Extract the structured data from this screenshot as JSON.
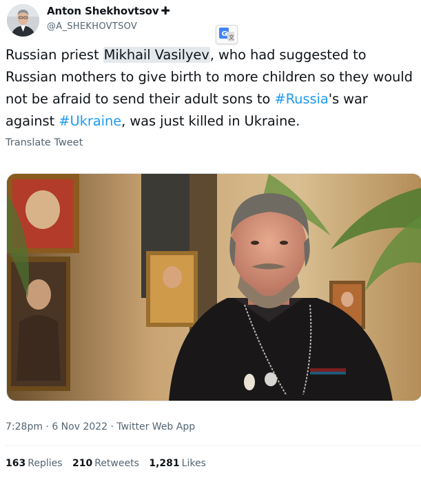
{
  "author": {
    "display_name": "Anton Shekhovtsov",
    "badge": "✚",
    "handle": "@A_SHEKHOVTSOV"
  },
  "tweet": {
    "segments": [
      {
        "text": "Russian priest ",
        "type": "text"
      },
      {
        "text": "Mikhail Vasilyev",
        "type": "highlight"
      },
      {
        "text": ", who had suggested to Russian mothers to give birth to more children so they would not be afraid to send their adult sons to ",
        "type": "text"
      },
      {
        "text": "#Russia",
        "type": "hashtag"
      },
      {
        "text": "'s war against ",
        "type": "text"
      },
      {
        "text": "#Ukraine",
        "type": "hashtag"
      },
      {
        "text": ", was just killed in Ukraine.",
        "type": "text"
      }
    ],
    "translate_label": "Translate Tweet",
    "timestamp": "7:28pm · 6 Nov 2022 · Twitter Web App"
  },
  "stats": {
    "replies_count": "163",
    "replies_label": "Replies",
    "retweets_count": "210",
    "retweets_label": "Retweets",
    "likes_count": "1,281",
    "likes_label": "Likes"
  },
  "icons": {
    "translate": "google-translate-icon",
    "verified": "cross-badge-icon"
  },
  "colors": {
    "hashtag": "#1d9bf0",
    "secondary_text": "#536471",
    "primary_text": "#0f1419",
    "highlight": "#e3e8ec"
  }
}
